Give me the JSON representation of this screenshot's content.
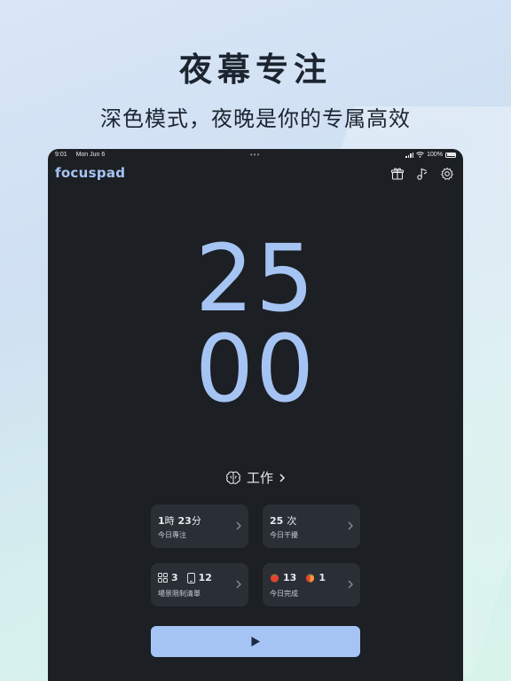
{
  "promo": {
    "headline": "夜幕专注",
    "subline": "深色模式，夜晚是你的专属高效"
  },
  "status_bar": {
    "time": "9:01",
    "date": "Mon Jun 6",
    "battery": "100%"
  },
  "app": {
    "logo": "focuspad",
    "icons": [
      "gift-icon",
      "music-note-icon",
      "gear-icon"
    ]
  },
  "timer": {
    "minutes": "25",
    "seconds": "00"
  },
  "mode": {
    "label": "工作",
    "icon": "brain-icon"
  },
  "stats": {
    "focus_time": {
      "value_hours": "1",
      "unit_hours": "時",
      "value_minutes": "23",
      "unit_minutes": "分",
      "label": "今日專注"
    },
    "interrupts": {
      "value": "25",
      "unit": "次",
      "label": "今日干擾"
    },
    "blocklist": {
      "apps_count": "3",
      "sites_count": "12",
      "label": "場景限制清單"
    },
    "completed": {
      "tomato_full": "13",
      "tomato_partial": "1",
      "label": "今日完成"
    }
  },
  "controls": {
    "play_icon": "play-icon"
  },
  "colors": {
    "accent": "#a5c4f3",
    "device_bg": "#1c1f24",
    "card_bg": "#2a2e35",
    "tomato": "#e2452f"
  }
}
